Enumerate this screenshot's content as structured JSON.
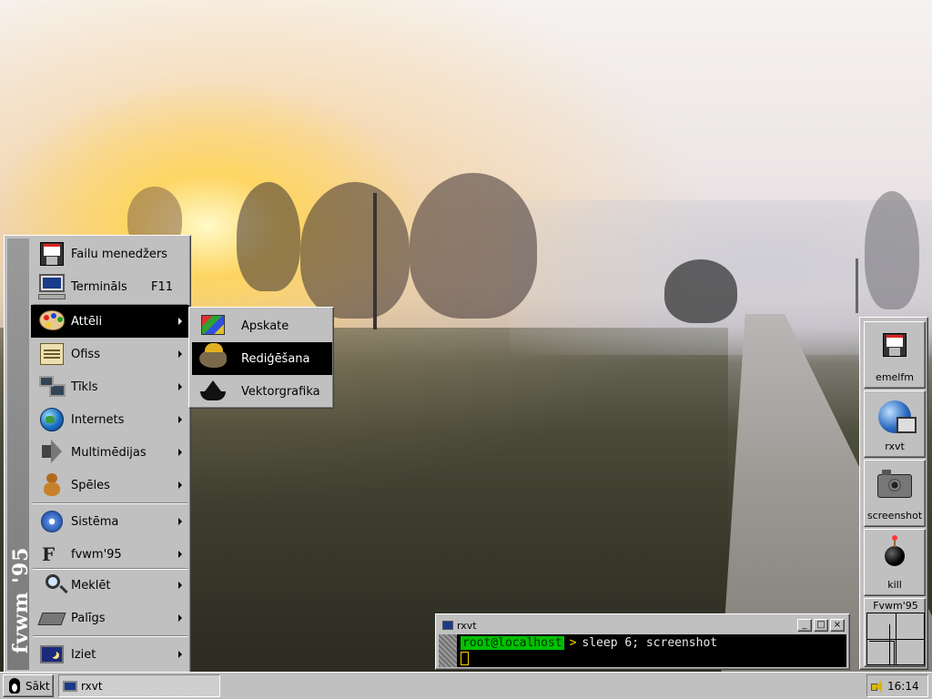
{
  "start_menu": {
    "brand": "fvwm '95",
    "items": [
      {
        "label": "Failu menedžers",
        "icon": "floppy-icon",
        "accelerator": "",
        "submenu": false
      },
      {
        "label": "Termināls",
        "icon": "terminal-icon",
        "accelerator": "F11",
        "submenu": false
      },
      {
        "label": "Attēli",
        "icon": "palette-icon",
        "accelerator": "",
        "submenu": true,
        "selected": true
      },
      {
        "label": "Ofiss",
        "icon": "office-icon",
        "accelerator": "",
        "submenu": true
      },
      {
        "label": "Tīkls",
        "icon": "network-icon",
        "accelerator": "",
        "submenu": true
      },
      {
        "label": "Internets",
        "icon": "globe-icon",
        "accelerator": "",
        "submenu": true
      },
      {
        "label": "Multimēdijas",
        "icon": "speaker-icon",
        "accelerator": "",
        "submenu": true
      },
      {
        "label": "Spēles",
        "icon": "teddy-bear-icon",
        "accelerator": "",
        "submenu": true
      },
      {
        "label": "Sistēma",
        "icon": "gear-icon",
        "accelerator": "",
        "submenu": true
      },
      {
        "label": "fvwm'95",
        "icon": "fvwm-icon",
        "accelerator": "",
        "submenu": true
      },
      {
        "label": "Meklēt",
        "icon": "search-icon",
        "accelerator": "",
        "submenu": true
      },
      {
        "label": "Palīgs",
        "icon": "help-book-icon",
        "accelerator": "",
        "submenu": true
      },
      {
        "label": "Iziet",
        "icon": "exit-icon",
        "accelerator": "",
        "submenu": true
      }
    ]
  },
  "submenu": {
    "items": [
      {
        "label": "Apskate",
        "icon": "image-viewer-icon"
      },
      {
        "label": "Rediģēšana",
        "icon": "gimp-icon",
        "selected": true
      },
      {
        "label": "Vektorgrafika",
        "icon": "inkscape-icon"
      }
    ]
  },
  "terminal_window": {
    "title": "rxvt",
    "prompt": "root@localhost",
    "prompt_arrow": ">",
    "command": "sleep 6; screenshot",
    "buttons": {
      "minimize": "_",
      "maximize": "□",
      "close": "×"
    }
  },
  "dock": {
    "buttons": [
      {
        "label": "emelfm",
        "icon": "floppy-icon"
      },
      {
        "label": "rxvt",
        "icon": "network-monitor-icon"
      },
      {
        "label": "screenshot",
        "icon": "camera-icon"
      },
      {
        "label": "kill",
        "icon": "bomb-icon"
      }
    ],
    "pager_label": "Fvwm'95"
  },
  "taskbar": {
    "start_label": "Sākt",
    "tasks": [
      {
        "label": "rxvt"
      }
    ],
    "clock": "16:14"
  },
  "colors": {
    "menu_bg": "#c0c0c0",
    "selection": "#000000",
    "prompt_bg": "#00c000",
    "prompt_arrow": "#ffd400",
    "terminal_bg": "#000000"
  }
}
